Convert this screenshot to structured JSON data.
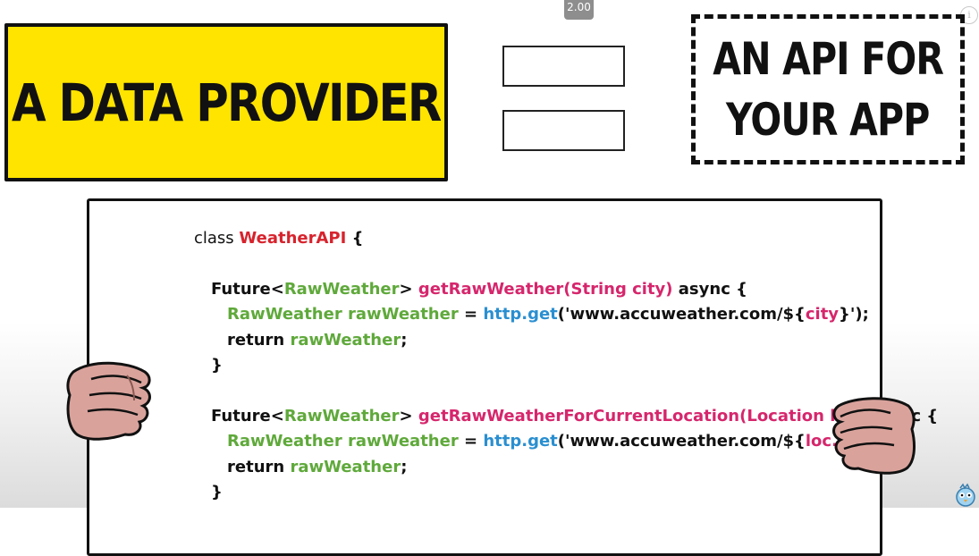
{
  "player": {
    "speed": "2.00",
    "info_glyph": "i"
  },
  "slide": {
    "left_title": "A DATA PROVIDER",
    "right_title_line1": "AN API FOR",
    "right_title_line2": "YOUR APP",
    "colors": {
      "yellow": "#ffe400",
      "class_red": "#d7232d",
      "type_green": "#5fa93b",
      "func_pink": "#d6266c",
      "http_blue": "#2a8fd0"
    }
  },
  "code": {
    "line1": {
      "kw": "class ",
      "name": "WeatherAPI",
      "end": " {"
    },
    "m1_sig": {
      "kw": "Future<",
      "type": "RawWeather",
      "gt": "> ",
      "fn": "getRawWeather(String city)",
      "end": " async {"
    },
    "m1_body": {
      "type": "RawWeather rawWeather",
      "eq": " = ",
      "http": "http.get",
      "open": "('www.accuweather.com/${",
      "arg": "city",
      "close": "}');"
    },
    "m1_ret": {
      "kw": "return ",
      "val": "rawWeather",
      "end": ";"
    },
    "m1_close": "}",
    "m2_sig": {
      "kw": "Future<",
      "type": "RawWeather",
      "gt": "> ",
      "fn": "getRawWeatherForCurrentLocation(Location loc)",
      "end": " async {"
    },
    "m2_body": {
      "type": "RawWeather rawWeather",
      "eq": " = ",
      "http": "http.get",
      "open": "('www.accuweather.com/${",
      "arg": "loc.city",
      "close": "}');"
    },
    "m2_ret": {
      "kw": "return ",
      "val": "rawWeather",
      "end": ";"
    },
    "m2_close": "}"
  }
}
